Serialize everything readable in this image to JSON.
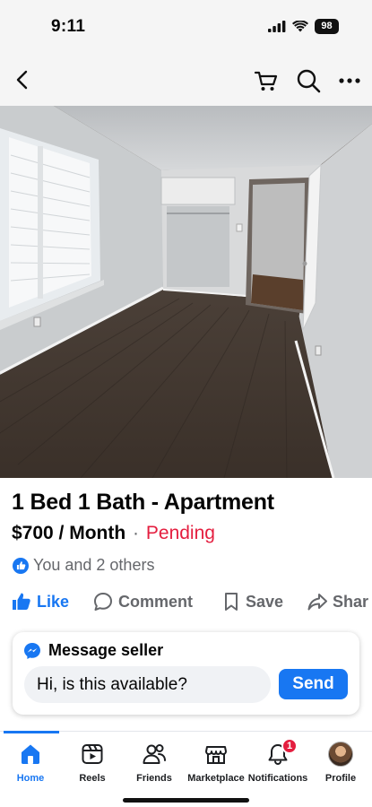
{
  "status_bar": {
    "time": "9:11",
    "battery": "98",
    "icons": [
      "signal-icon",
      "wifi-icon",
      "battery-icon"
    ]
  },
  "nav": {
    "icons": [
      "back-icon",
      "cart-icon",
      "search-icon",
      "more-icon"
    ]
  },
  "listing": {
    "photo_count": 5,
    "active_photo_index": 3,
    "title": "1 Bed 1 Bath - Apartment",
    "price": "$700 / Month",
    "separator": "·",
    "status": "Pending",
    "likes_text": "You and 2 others"
  },
  "actions": {
    "like": "Like",
    "comment": "Comment",
    "save": "Save",
    "share": "Shar"
  },
  "message": {
    "header": "Message seller",
    "input_value": "Hi, is this available?",
    "send": "Send"
  },
  "tabs": [
    {
      "label": "Home",
      "active": true,
      "icon": "home-icon"
    },
    {
      "label": "Reels",
      "active": false,
      "icon": "reels-icon"
    },
    {
      "label": "Friends",
      "active": false,
      "icon": "friends-icon"
    },
    {
      "label": "Marketplace",
      "active": false,
      "icon": "marketplace-icon"
    },
    {
      "label": "Notifications",
      "active": false,
      "icon": "bell-icon",
      "badge": "1"
    },
    {
      "label": "Profile",
      "active": false,
      "icon": "avatar"
    }
  ],
  "colors": {
    "accent": "#1877f2",
    "pending": "#e41e3f",
    "muted": "#65676b"
  }
}
